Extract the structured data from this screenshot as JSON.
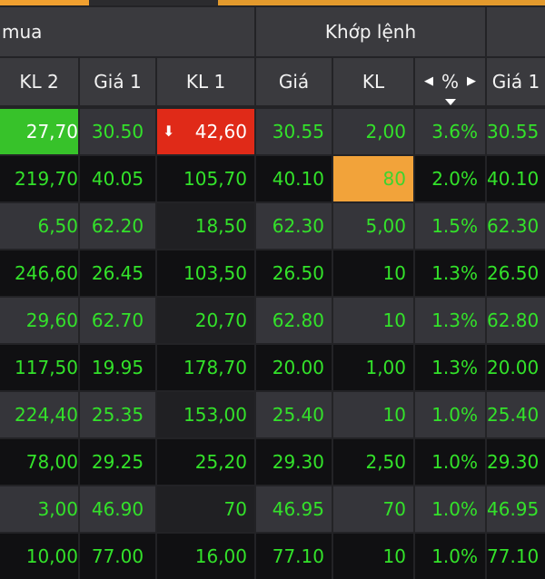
{
  "header": {
    "group_left": "mua",
    "group_match": "Khớp lệnh"
  },
  "columns": [
    "KL 2",
    "Giá 1",
    "KL 1",
    "Giá",
    "KL",
    "%",
    "Giá 1"
  ],
  "nav": {
    "left_icon": "triangle-left",
    "right_icon": "triangle-right",
    "sort_icon": "sort-down"
  },
  "rows": [
    [
      "27,70",
      "30.50",
      "42,60",
      "30.55",
      "2,00",
      "3.6%",
      "30.55"
    ],
    [
      "219,70",
      "40.05",
      "105,70",
      "40.10",
      "80",
      "2.0%",
      "40.10"
    ],
    [
      "6,50",
      "62.20",
      "18,50",
      "62.30",
      "5,00",
      "1.5%",
      "62.30"
    ],
    [
      "246,60",
      "26.45",
      "103,50",
      "26.50",
      "10",
      "1.3%",
      "26.50"
    ],
    [
      "29,60",
      "62.70",
      "20,70",
      "62.80",
      "10",
      "1.3%",
      "62.80"
    ],
    [
      "117,50",
      "19.95",
      "178,70",
      "20.00",
      "1,00",
      "1.3%",
      "20.00"
    ],
    [
      "224,40",
      "25.35",
      "153,00",
      "25.40",
      "10",
      "1.0%",
      "25.40"
    ],
    [
      "78,00",
      "29.25",
      "25,20",
      "29.30",
      "2,50",
      "1.0%",
      "29.30"
    ],
    [
      "3,00",
      "46.90",
      "70",
      "46.95",
      "70",
      "1.0%",
      "46.95"
    ],
    [
      "10,00",
      "77.00",
      "16,00",
      "77.10",
      "10",
      "1.0%",
      "77.10"
    ]
  ],
  "colors": {
    "up": "#33e22a",
    "down": "#e02a18",
    "highlight": "#f2a33a"
  }
}
